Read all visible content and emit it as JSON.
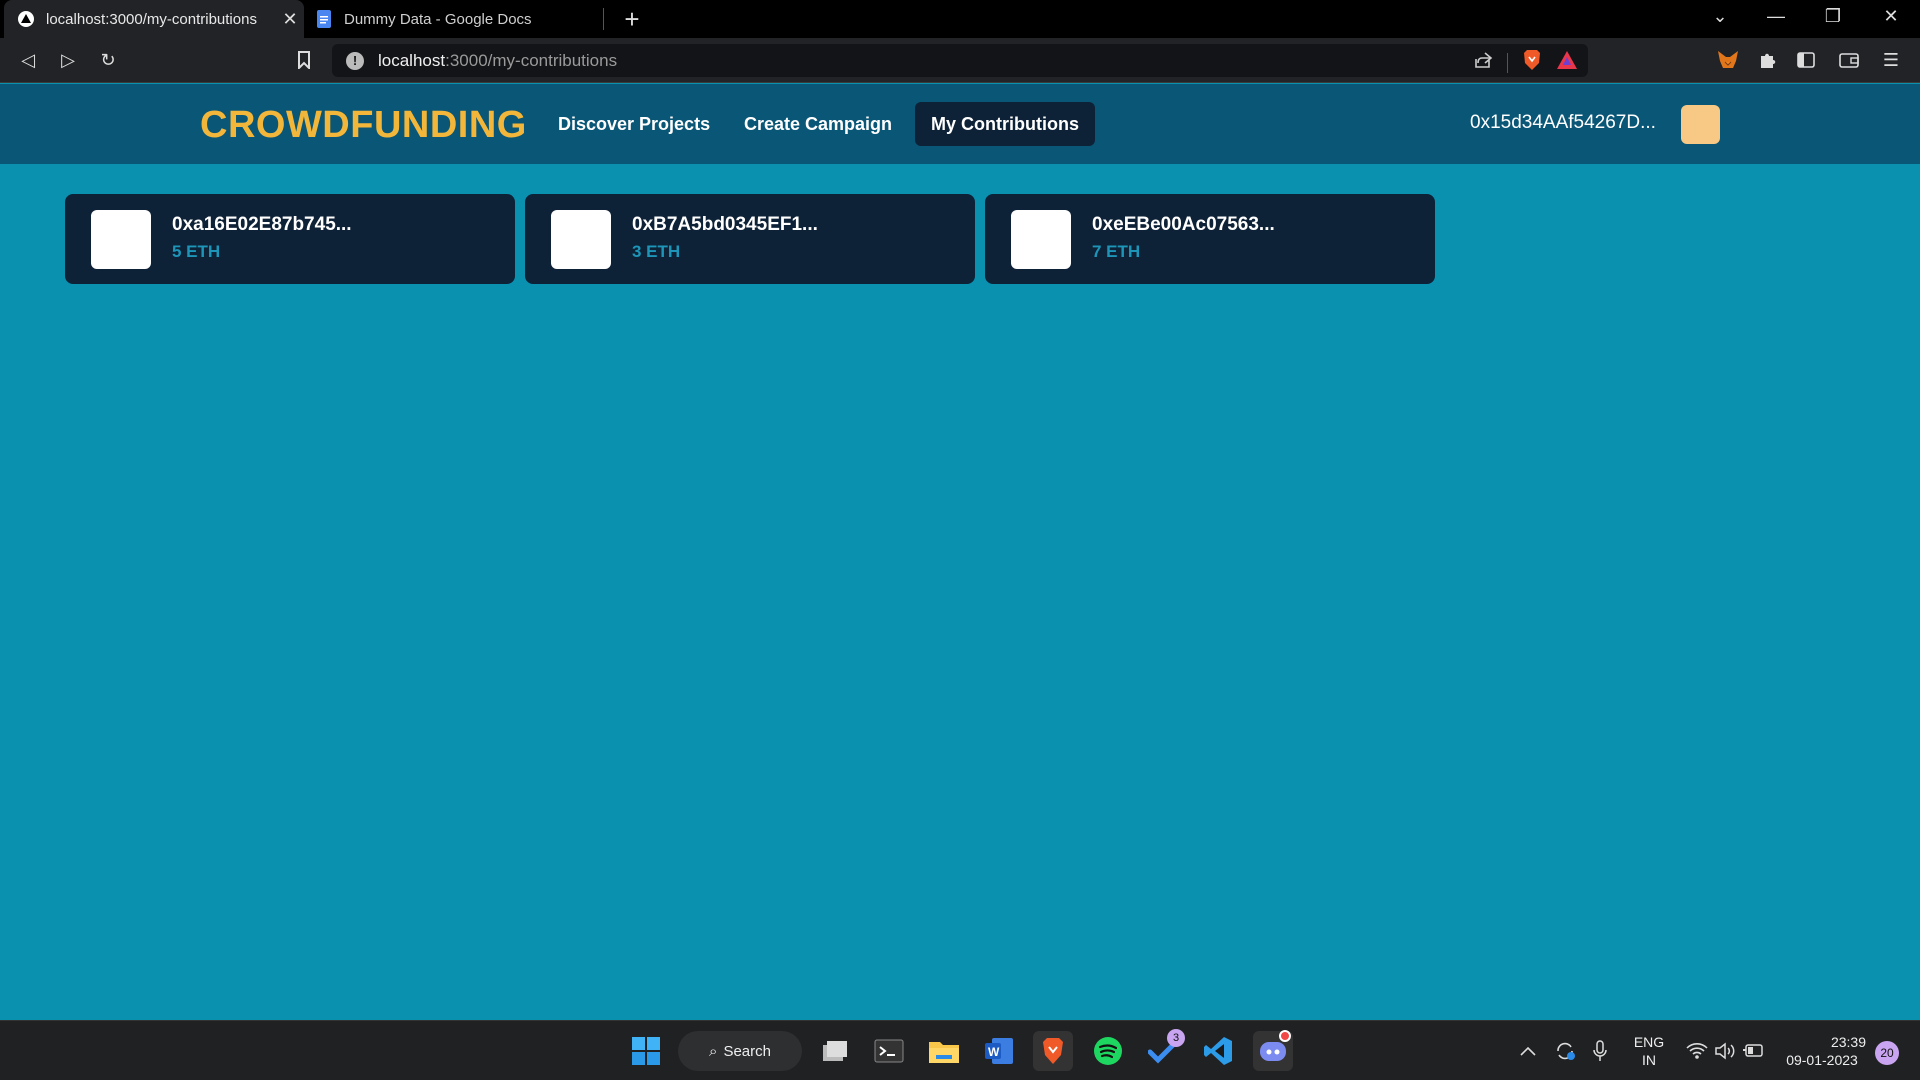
{
  "browser": {
    "tabs": [
      {
        "title": "localhost:3000/my-contributions",
        "active": true
      },
      {
        "title": "Dummy Data - Google Docs",
        "active": false
      }
    ],
    "url_host": "localhost",
    "url_path": ":3000/my-contributions"
  },
  "app": {
    "brand": "CROWDFUNDING",
    "nav": [
      {
        "label": "Discover Projects"
      },
      {
        "label": "Create Campaign"
      },
      {
        "label": "My Contributions",
        "active": true
      }
    ],
    "wallet_address": "0x15d34AAf54267D...",
    "avatar_color": "#f8c985"
  },
  "contributions": [
    {
      "address": "0xa16E02E87b745...",
      "amount": "5 ETH"
    },
    {
      "address": "0xB7A5bd0345EF1...",
      "amount": "3 ETH"
    },
    {
      "address": "0xeEBe00Ac07563...",
      "amount": "7 ETH"
    }
  ],
  "colors": {
    "page_bg": "#0b91b0",
    "header_bg": "#0a5676",
    "card_bg": "#0e2237",
    "brand": "#f2b63a",
    "amount": "#1c95b8"
  },
  "taskbar": {
    "search_label": "Search",
    "lang_line1": "ENG",
    "lang_line2": "IN",
    "time": "23:39",
    "date": "09-01-2023",
    "notification_count": "20",
    "todo_badge": "3"
  }
}
